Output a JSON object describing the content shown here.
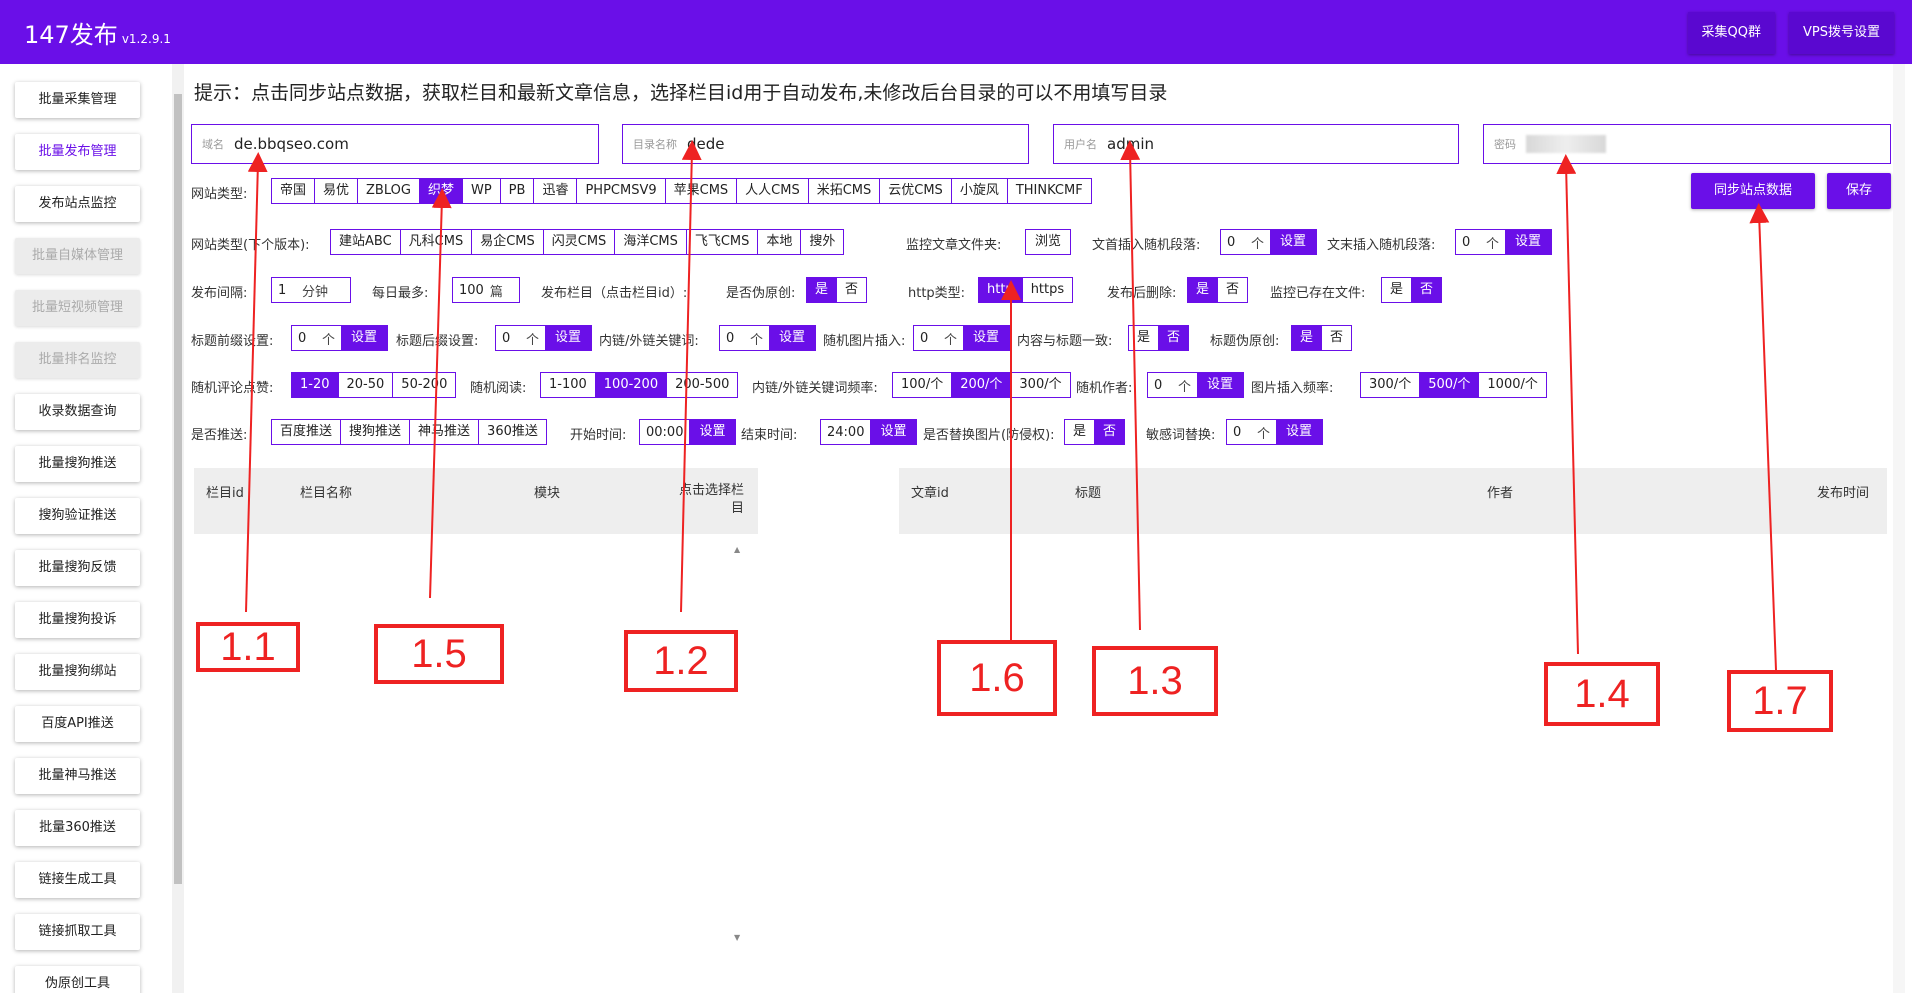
{
  "app": {
    "title": "147发布",
    "version": "v1.2.9.1"
  },
  "topbar": {
    "qq_group": "采集QQ群",
    "vps_settings": "VPS拨号设置"
  },
  "sidebar": {
    "items": [
      {
        "label": "批量采集管理",
        "state": "normal"
      },
      {
        "label": "批量发布管理",
        "state": "active"
      },
      {
        "label": "发布站点监控",
        "state": "normal"
      },
      {
        "label": "批量自媒体管理",
        "state": "disabled"
      },
      {
        "label": "批量短视频管理",
        "state": "disabled"
      },
      {
        "label": "批量排名监控",
        "state": "disabled"
      },
      {
        "label": "收录数据查询",
        "state": "normal"
      },
      {
        "label": "批量搜狗推送",
        "state": "normal"
      },
      {
        "label": "搜狗验证推送",
        "state": "normal"
      },
      {
        "label": "批量搜狗反馈",
        "state": "normal"
      },
      {
        "label": "批量搜狗投诉",
        "state": "normal"
      },
      {
        "label": "批量搜狗绑站",
        "state": "normal"
      },
      {
        "label": "百度API推送",
        "state": "normal"
      },
      {
        "label": "批量神马推送",
        "state": "normal"
      },
      {
        "label": "批量360推送",
        "state": "normal"
      },
      {
        "label": "链接生成工具",
        "state": "normal"
      },
      {
        "label": "链接抓取工具",
        "state": "normal"
      },
      {
        "label": "伪原创工具",
        "state": "normal"
      }
    ]
  },
  "tip": "提示：点击同步站点数据，获取栏目和最新文章信息，选择栏目id用于自动发布,未修改后台目录的可以不用填写目录",
  "fields": {
    "domain": {
      "label": "域名",
      "value": "de.bbqseo.com"
    },
    "directory": {
      "label": "目录名称",
      "value": "dede"
    },
    "username": {
      "label": "用户名",
      "value": "admin"
    },
    "password": {
      "label": "密码",
      "value": ""
    }
  },
  "site_type": {
    "label": "网站类型:",
    "options": [
      "帝国",
      "易优",
      "ZBLOG",
      "织梦",
      "WP",
      "PB",
      "迅睿",
      "PHPCMSV9",
      "苹果CMS",
      "人人CMS",
      "米拓CMS",
      "云优CMS",
      "小旋风",
      "THINKCMF"
    ],
    "selected": "织梦"
  },
  "site_type2": {
    "label": "网站类型(下个版本):",
    "options": [
      "建站ABC",
      "凡科CMS",
      "易企CMS",
      "闪灵CMS",
      "海洋CMS",
      "飞飞CMS",
      "本地",
      "搜外"
    ]
  },
  "actions": {
    "sync": "同步站点数据",
    "save": "保存"
  },
  "row2": {
    "monitor_folder": "监控文章文件夹:",
    "browse": "浏览",
    "head_random": "文首插入随机段落:",
    "head_random_value": "0",
    "unit_ge": "个",
    "set": "设置",
    "tail_random": "文末插入随机段落:",
    "tail_random_value": "0"
  },
  "row3": {
    "interval_label": "发布间隔:",
    "interval_value": "1",
    "interval_unit": "分钟",
    "daily_max_label": "每日最多:",
    "daily_max_value": "100",
    "daily_max_unit": "篇",
    "column_label": "发布栏目（点击栏目id）:",
    "pseudo_label": "是否伪原创:",
    "yes": "是",
    "no": "否",
    "http_label": "http类型:",
    "http": "http",
    "https": "https",
    "delete_label": "发布后删除:",
    "exists_label": "监控已存在文件:"
  },
  "row4": {
    "prefix_label": "标题前缀设置:",
    "prefix_value": "0",
    "suffix_label": "标题后缀设置:",
    "suffix_value": "0",
    "keyword_label": "内链/外链关键词:",
    "keyword_value": "0",
    "image_label": "随机图片插入:",
    "image_value": "0",
    "consistent_label": "内容与标题一致:",
    "title_pseudo_label": "标题伪原创:"
  },
  "row5": {
    "comment_label": "随机评论点赞:",
    "comment_options": [
      "1-20",
      "20-50",
      "50-200"
    ],
    "comment_selected": "1-20",
    "read_label": "随机阅读:",
    "read_options": [
      "1-100",
      "100-200",
      "200-500"
    ],
    "read_selected": "100-200",
    "freq_label": "内链/外链关键词频率:",
    "freq_options": [
      "100/个",
      "200/个",
      "300/个"
    ],
    "freq_selected": "200/个",
    "author_label": "随机作者:",
    "author_value": "0",
    "img_freq_label": "图片插入频率:",
    "img_freq_options": [
      "300/个",
      "500/个",
      "1000/个"
    ],
    "img_freq_selected": "500/个"
  },
  "row6": {
    "push_label": "是否推送:",
    "push_options": [
      "百度推送",
      "搜狗推送",
      "神马推送",
      "360推送"
    ],
    "start_label": "开始时间:",
    "start_value": "00:00",
    "end_label": "结束时间:",
    "end_value": "24:00",
    "replace_img_label": "是否替换图片(防侵权):",
    "sensitive_label": "敏感词替换:",
    "sensitive_value": "0"
  },
  "left_table": {
    "headers": [
      "栏目id",
      "栏目名称",
      "模块",
      "点击选择栏目"
    ]
  },
  "right_table": {
    "headers": [
      "文章id",
      "标题",
      "作者",
      "发布时间"
    ]
  },
  "annotations": [
    "1.1",
    "1.5",
    "1.2",
    "1.6",
    "1.3",
    "1.4",
    "1.7"
  ],
  "colors": {
    "brand": "#6a0fe8",
    "annotation": "#ee2222"
  }
}
